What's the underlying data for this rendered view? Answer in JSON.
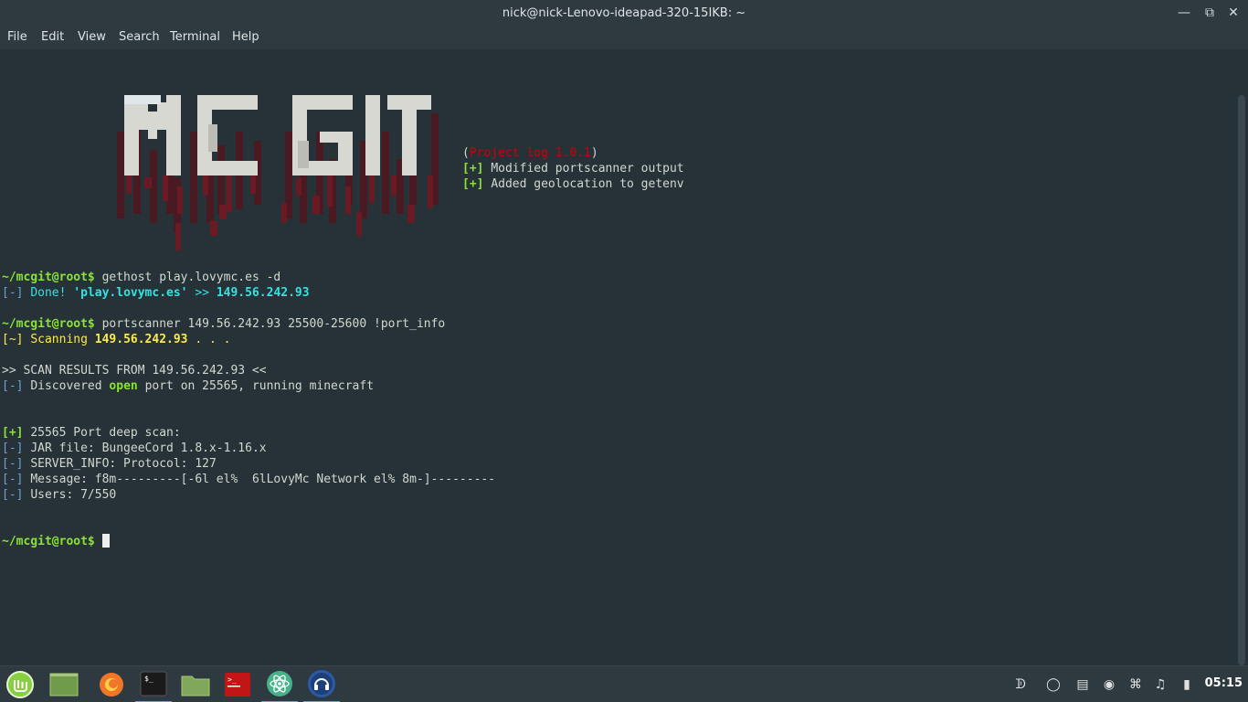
{
  "window": {
    "title": "nick@nick-Lenovo-ideapad-320-15IKB: ~"
  },
  "menu": [
    "File",
    "Edit",
    "View",
    "Search",
    "Terminal",
    "Help"
  ],
  "banner_text": "MC GIT",
  "project_log": {
    "open_paren": "(",
    "title": "Project log 1.0.1",
    "close_paren": ")",
    "tag": "[+]",
    "entries": [
      "Modified portscanner output",
      "Added geolocation to getenv"
    ]
  },
  "prompt": "~/mcgit@root$",
  "commands": {
    "gethost": "gethost play.lovymc.es -d",
    "portscanner": "portscanner 149.56.242.93 25500-25600 !port_info"
  },
  "gethost_result": {
    "tag": "[-]",
    "label": "Done!",
    "host": "'play.lovymc.es'",
    "arrow": ">>",
    "ip": "149.56.242.93"
  },
  "scanning": {
    "tag": "[~]",
    "label": "Scanning",
    "ip": "149.56.242.93",
    "dots": ". . ."
  },
  "scan_results": {
    "header": ">> SCAN RESULTS FROM 149.56.242.93 <<",
    "tag": "[-]",
    "pre": "Discovered",
    "state": "open",
    "post": "port on 25565, running minecraft"
  },
  "deep_scan": {
    "header_tag": "[+]",
    "header": "25565 Port deep scan:",
    "tag": "[-]",
    "lines": [
      "JAR file: BungeeCord 1.8.x-1.16.x",
      "SERVER_INFO: Protocol: 127",
      "Message: f8m---------[-6l el%  6lLovyMc Network el% 8m-]---------",
      "Users: 7/550"
    ]
  },
  "taskbar": {
    "apps": [
      "menu-icon",
      "desktop-icon",
      "firefox-icon",
      "terminal-icon",
      "files-icon",
      "terminal-red-icon",
      "atom-icon",
      "headset-icon"
    ],
    "clock": "05:15",
    "colors": {
      "mint": "#87cf3e",
      "firefox": "#f0772a",
      "atom": "#47b28a",
      "accent": "#4fb3d6"
    }
  }
}
